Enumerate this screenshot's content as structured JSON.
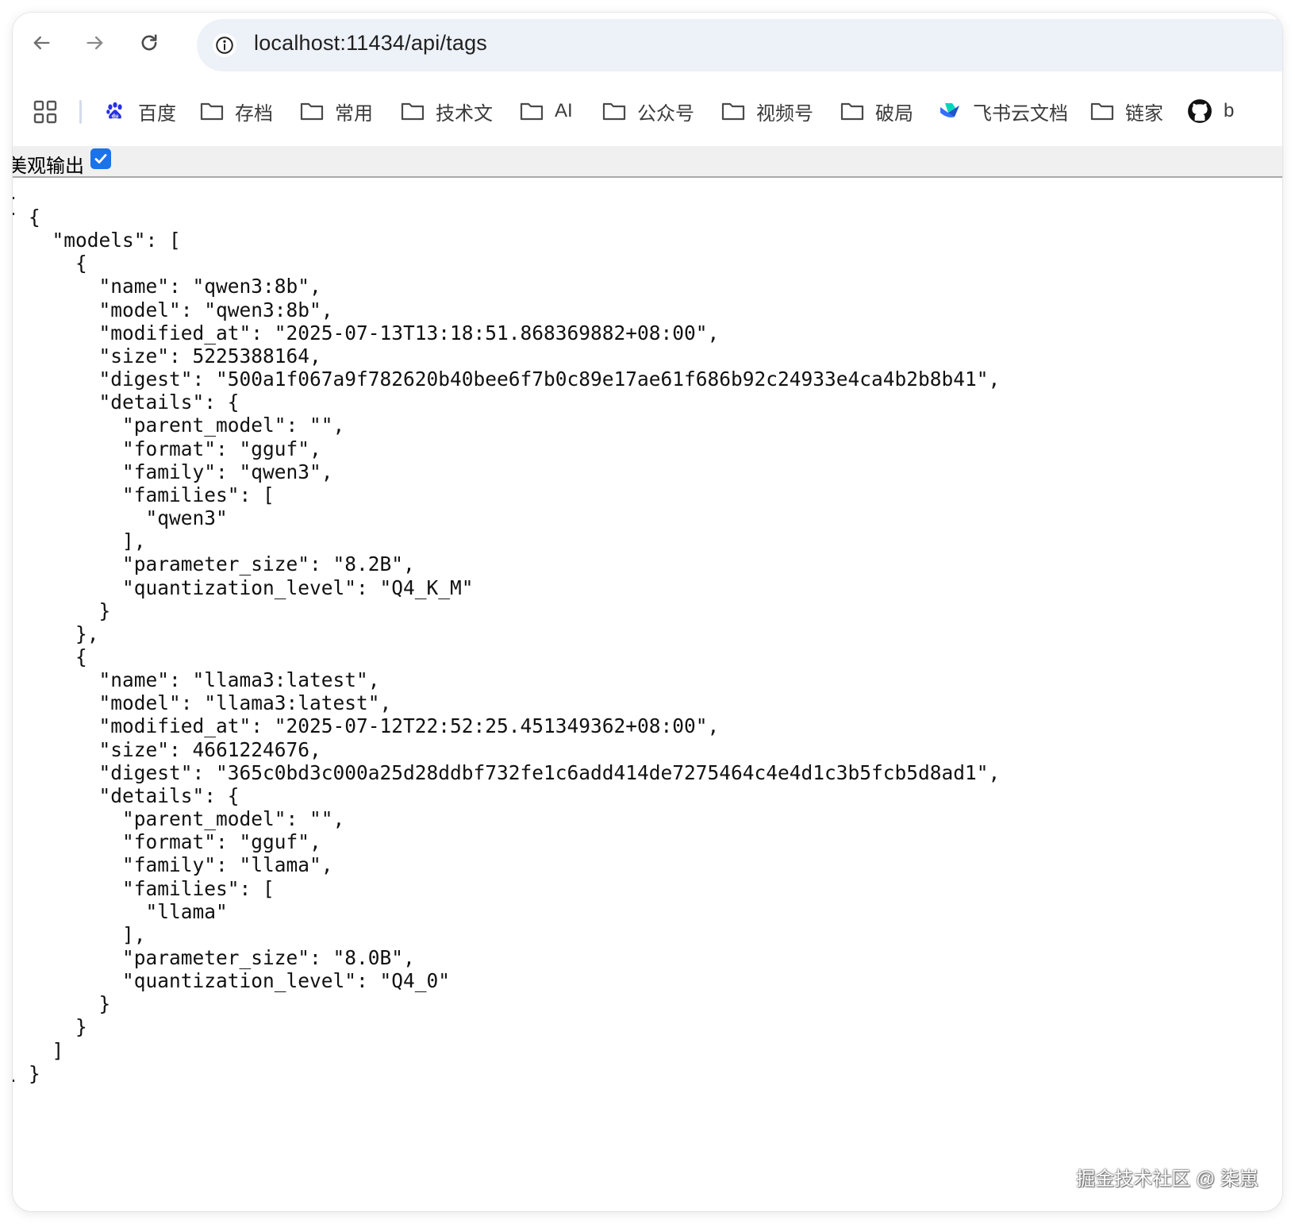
{
  "browser": {
    "url": "localhost:11434/api/tags",
    "bookmarks": [
      {
        "label": "百度",
        "icon": "baidu-paw-icon"
      },
      {
        "label": "存档",
        "icon": "folder-icon"
      },
      {
        "label": "常用",
        "icon": "folder-icon"
      },
      {
        "label": "技术文",
        "icon": "folder-icon"
      },
      {
        "label": "AI",
        "icon": "folder-icon"
      },
      {
        "label": "公众号",
        "icon": "folder-icon"
      },
      {
        "label": "视频号",
        "icon": "folder-icon"
      },
      {
        "label": "破局",
        "icon": "folder-icon"
      },
      {
        "label": "飞书云文档",
        "icon": "feishu-icon"
      },
      {
        "label": "链家",
        "icon": "folder-icon"
      },
      {
        "label": "b",
        "icon": "github-icon"
      }
    ]
  },
  "viewer": {
    "pretty_print_label": "美观输出",
    "pretty_print_checked": true,
    "json_lines": [
      "{",
      "  \"models\": [",
      "    {",
      "      \"name\": \"qwen3:8b\",",
      "      \"model\": \"qwen3:8b\",",
      "      \"modified_at\": \"2025-07-13T13:18:51.868369882+08:00\",",
      "      \"size\": 5225388164,",
      "      \"digest\": \"500a1f067a9f782620b40bee6f7b0c89e17ae61f686b92c24933e4ca4b2b8b41\",",
      "      \"details\": {",
      "        \"parent_model\": \"\",",
      "        \"format\": \"gguf\",",
      "        \"family\": \"qwen3\",",
      "        \"families\": [",
      "          \"qwen3\"",
      "        ],",
      "        \"parameter_size\": \"8.2B\",",
      "        \"quantization_level\": \"Q4_K_M\"",
      "      }",
      "    },",
      "    {",
      "      \"name\": \"llama3:latest\",",
      "      \"model\": \"llama3:latest\",",
      "      \"modified_at\": \"2025-07-12T22:52:25.451349362+08:00\",",
      "      \"size\": 4661224676,",
      "      \"digest\": \"365c0bd3c000a25d28ddbf732fe1c6add414de7275464c4e4d1c3b5fcb5d8ad1\",",
      "      \"details\": {",
      "        \"parent_model\": \"\",",
      "        \"format\": \"gguf\",",
      "        \"family\": \"llama\",",
      "        \"families\": [",
      "          \"llama\"",
      "        ],",
      "        \"parameter_size\": \"8.0B\",",
      "        \"quantization_level\": \"Q4_0\"",
      "      }",
      "    }",
      "  ]",
      "}"
    ]
  },
  "watermark": "掘金技术社区 @ 柒崽",
  "colors": {
    "accent": "#1a73e8",
    "address_bg": "#edf1f8",
    "pretty_bar_bg": "#f0f0f0"
  }
}
